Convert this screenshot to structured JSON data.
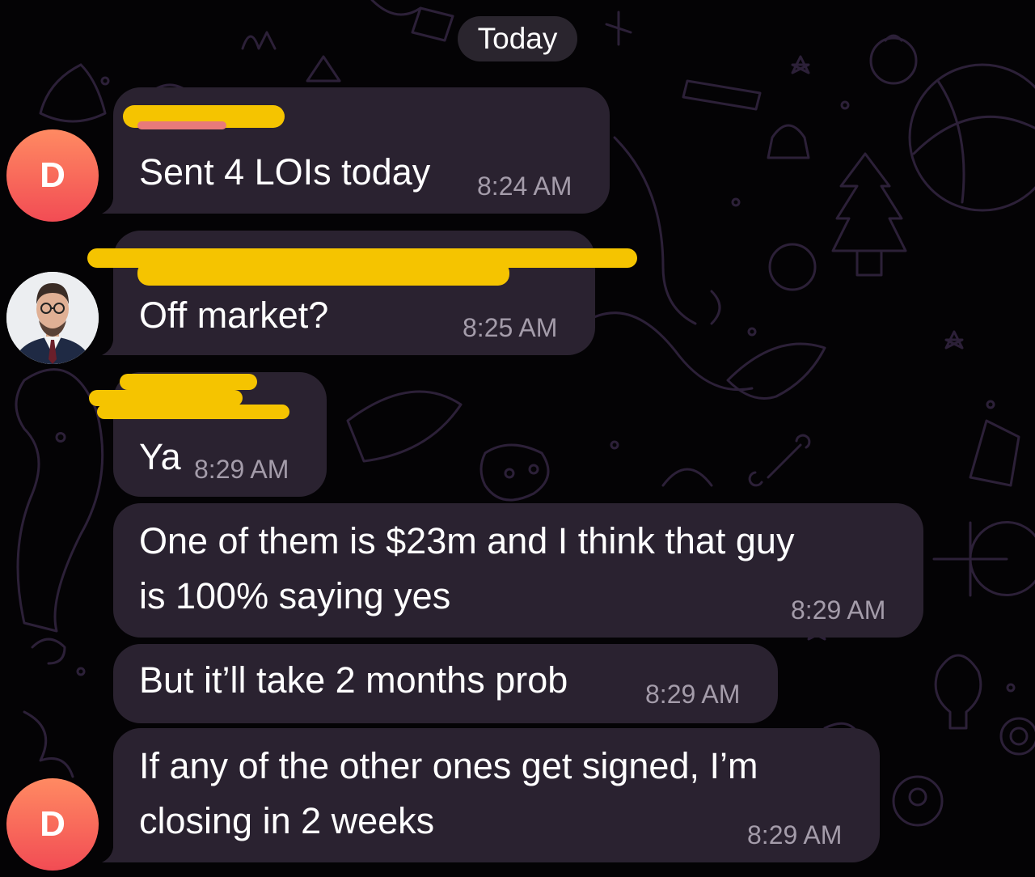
{
  "date_divider": "Today",
  "colors": {
    "background": "#040305",
    "bubble": "#2a2230",
    "text": "#ffffff",
    "timestamp": "#a49caa",
    "redaction": "#f5c400",
    "avatar_gradient_top": "#ff8a62",
    "avatar_gradient_bottom": "#f24c54"
  },
  "messages": [
    {
      "text": "Sent 4 LOIs today",
      "time": "8:24 AM",
      "sender_redacted": true,
      "avatar": "D"
    },
    {
      "text": "Off market?",
      "time": "8:25 AM",
      "sender_redacted": true,
      "avatar": "profile-photo"
    },
    {
      "text": "Ya",
      "time": "8:29 AM",
      "sender_redacted": true
    },
    {
      "lines": [
        "One of them is $23m and I think that guy",
        "is 100% saying yes"
      ],
      "time": "8:29 AM"
    },
    {
      "text": "But it’ll take 2 months prob",
      "time": "8:29 AM"
    },
    {
      "lines": [
        "If any of the other ones get signed, I’m",
        "closing in 2 weeks"
      ],
      "time": "8:29 AM",
      "avatar": "D"
    }
  ],
  "icons": {
    "background": "doodle-pattern",
    "redaction": "scribble-redaction"
  }
}
